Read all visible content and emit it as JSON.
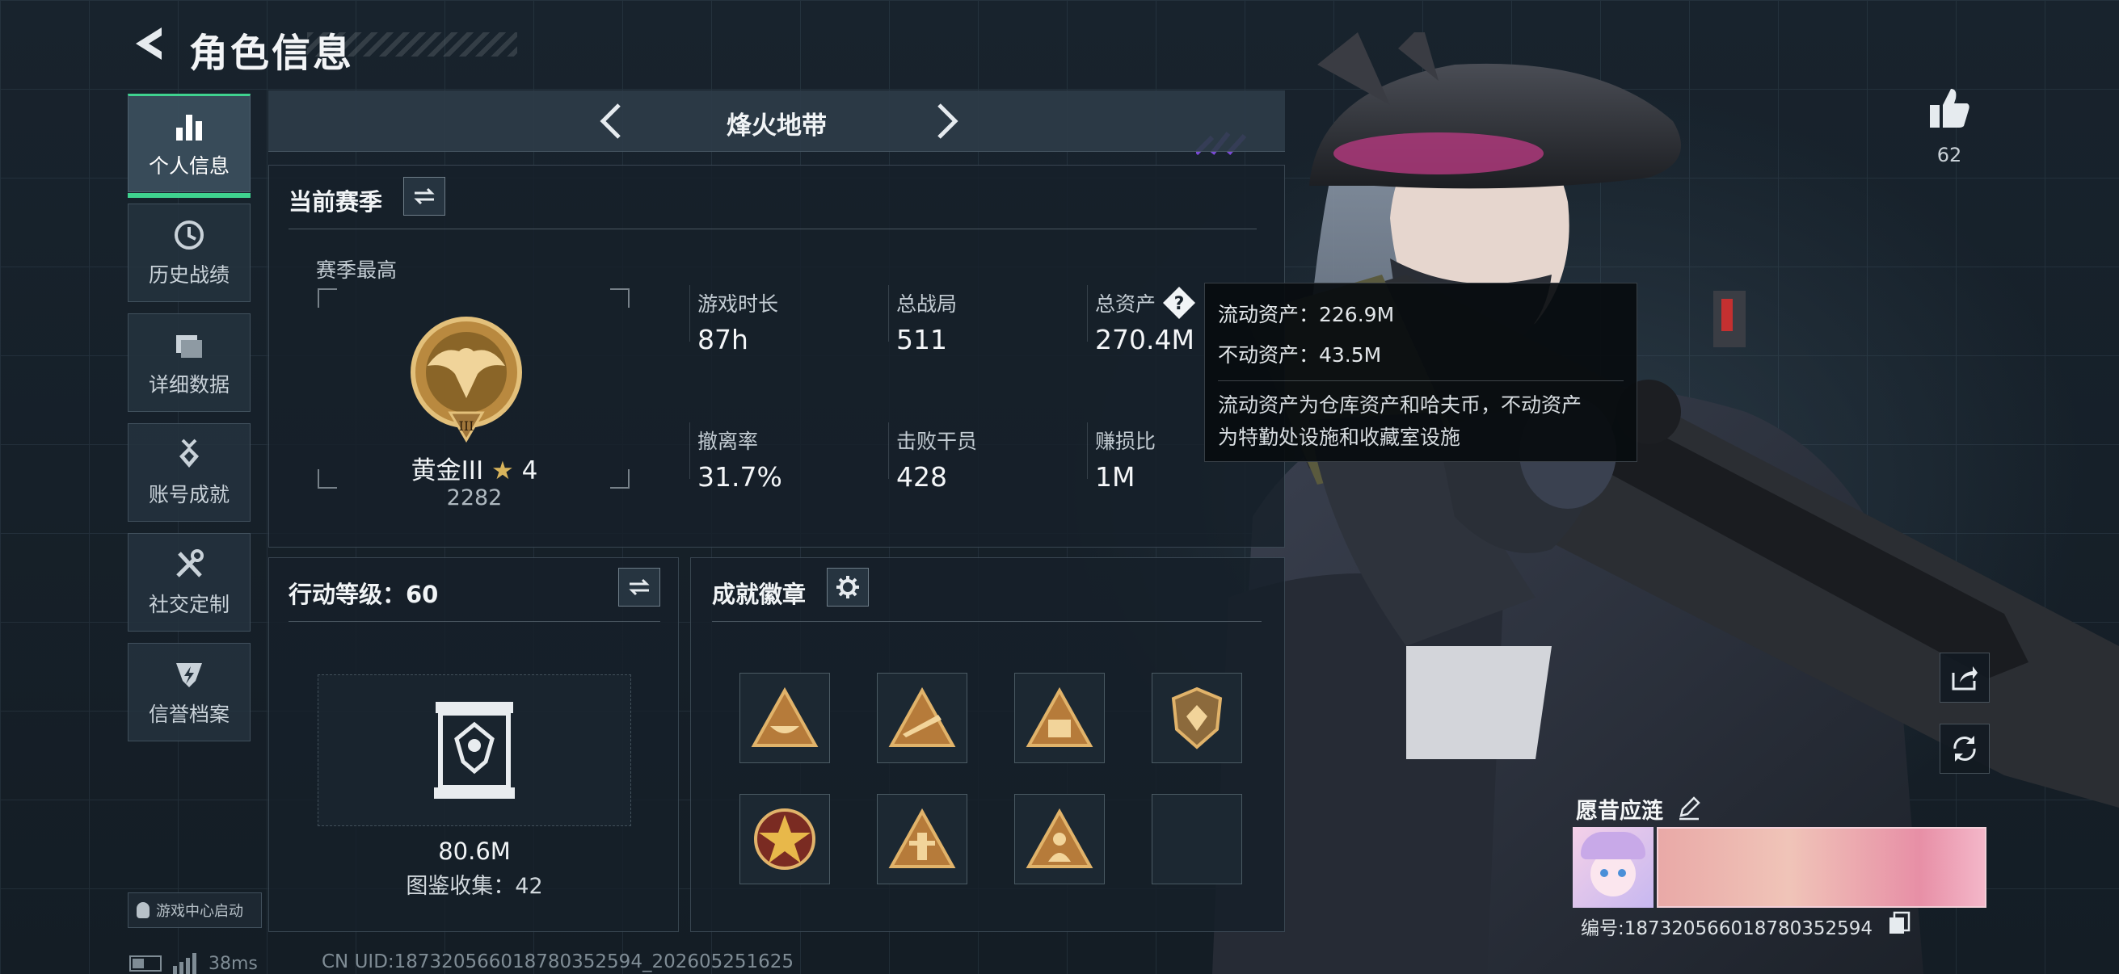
{
  "header": {
    "title": "角色信息",
    "back_icon": "back-arrow-icon"
  },
  "nav": {
    "items": [
      {
        "label": "个人信息",
        "icon": "bar-chart-icon",
        "active": true
      },
      {
        "label": "历史战绩",
        "icon": "history-clock-icon",
        "active": false
      },
      {
        "label": "详细数据",
        "icon": "folder-icon",
        "active": false
      },
      {
        "label": "账号成就",
        "icon": "medal-icon",
        "active": false
      },
      {
        "label": "社交定制",
        "icon": "tools-icon",
        "active": false
      },
      {
        "label": "信誉档案",
        "icon": "shield-bolt-icon",
        "active": false
      }
    ],
    "game_center_label": "游戏中心启动"
  },
  "status_bar": {
    "ping": "38ms",
    "uid": "CN UID:18732056601878035259­4_202605251625"
  },
  "mode": {
    "title": "烽火地带"
  },
  "season": {
    "title": "当前赛季",
    "best_label": "赛季最高",
    "rank_name": "黄金III",
    "rank_stars": "4",
    "rank_score": "2282",
    "stats": [
      {
        "label": "游戏时长",
        "value": "87h"
      },
      {
        "label": "总战局",
        "value": "511"
      },
      {
        "label": "总资产",
        "value": "270.4M"
      },
      {
        "label": "撤离率",
        "value": "31.7%"
      },
      {
        "label": "击败干员",
        "value": "428"
      },
      {
        "label": "赚损比",
        "value": "1M"
      }
    ]
  },
  "tooltip": {
    "liquid": "流动资产：226.9M",
    "fixed": "不动资产：43.5M",
    "desc_line1": "流动资产为仓库资产和哈夫币，不动资产",
    "desc_line2": "为特勤处设施和收藏室设施"
  },
  "action_level": {
    "title": "行动等级：60",
    "collection_value": "80.6M",
    "collection_label": "图鉴收集：42"
  },
  "achievements": {
    "title": "成就徽章",
    "badges": [
      "badge-triangle-bowl",
      "badge-triangle-rifle",
      "badge-triangle-crate",
      "badge-shield",
      "badge-star-medal",
      "badge-triangle-tower",
      "badge-triangle-soldier",
      "empty"
    ]
  },
  "social": {
    "like_count": "62"
  },
  "player": {
    "name": "愿昔应涟",
    "id_text": "编号:18732056601878035259­4"
  },
  "colors": {
    "accent": "#3fd28f",
    "gold": "#c9a25a",
    "panel_bg": "#16202a"
  }
}
